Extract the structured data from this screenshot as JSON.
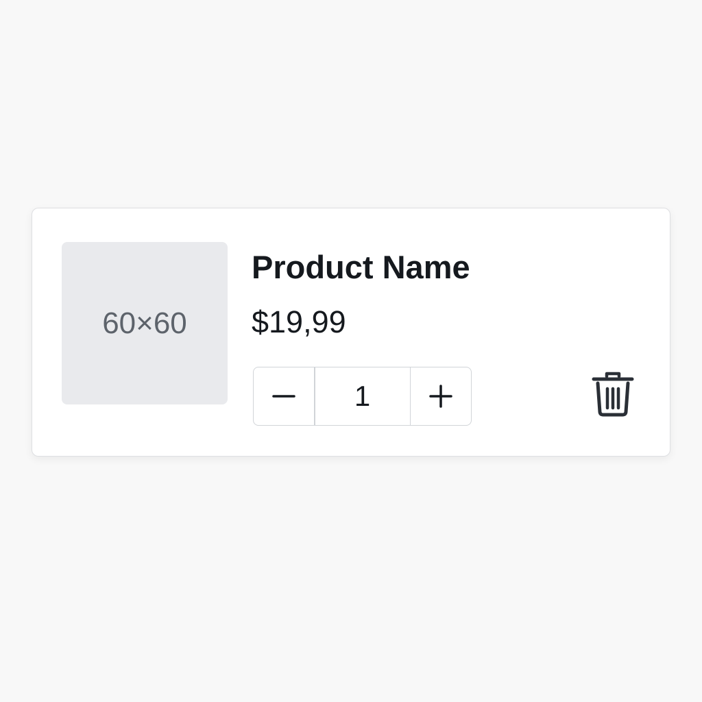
{
  "product": {
    "image_placeholder": "60×60",
    "name": "Product Name",
    "price": "$19,99"
  },
  "quantity": {
    "value": "1"
  },
  "icons": {
    "decrement": "minus-icon",
    "increment": "plus-icon",
    "remove": "trash-icon"
  },
  "colors": {
    "text": "#15191e",
    "placeholder_bg": "#e9eaed",
    "placeholder_text": "#5d636b",
    "border": "#d1d4d8",
    "page_bg": "#f8f8f8"
  }
}
